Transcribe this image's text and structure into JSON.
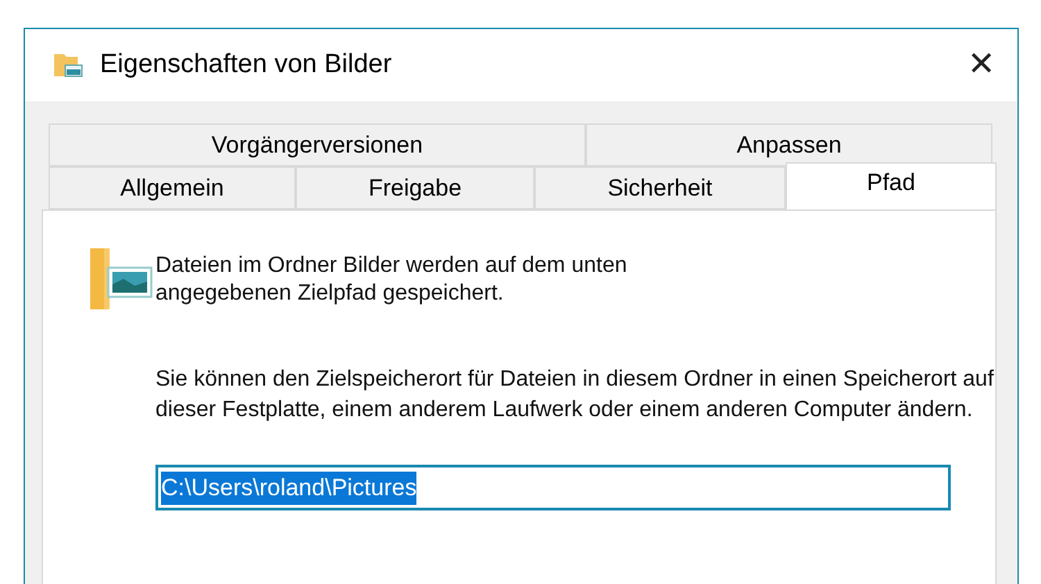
{
  "window": {
    "title": "Eigenschaften von Bilder",
    "close": "✕"
  },
  "tab_rows": [
    [
      {
        "label": "Vorgängerversionen",
        "selected": false
      },
      {
        "label": "Anpassen",
        "selected": false
      }
    ],
    [
      {
        "label": "Allgemein",
        "selected": false
      },
      {
        "label": "Freigabe",
        "selected": false
      },
      {
        "label": "Sicherheit",
        "selected": false
      },
      {
        "label": "Pfad",
        "selected": true
      }
    ]
  ],
  "intro": "Dateien im Ordner Bilder werden auf dem unten angegebenen Zielpfad gespeichert.",
  "description": "Sie können den Zielspeicherort für Dateien in diesem Ordner in einen Speicherort auf dieser Festplatte, einem anderem Laufwerk oder einem anderen Computer ändern.",
  "path_field": {
    "value": "C:\\Users\\roland\\Pictures",
    "highlighted": true
  }
}
